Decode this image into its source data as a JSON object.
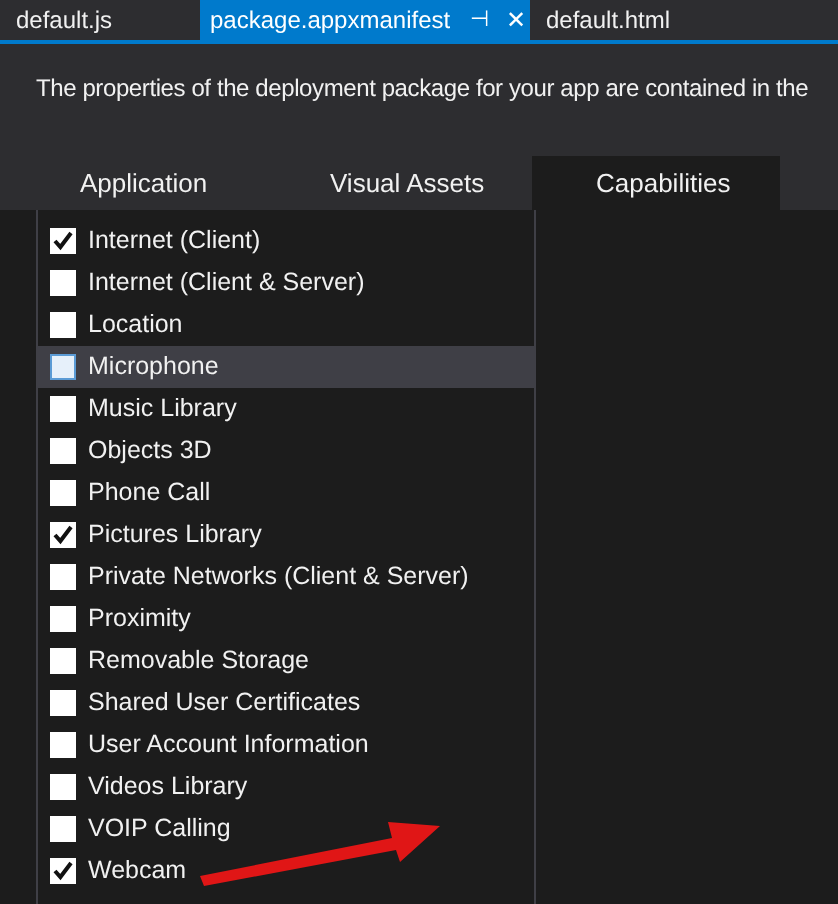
{
  "file_tabs": [
    {
      "label": "default.js",
      "selected": false
    },
    {
      "label": "package.appxmanifest",
      "selected": true,
      "pin": "⊣",
      "close": "✕"
    },
    {
      "label": "default.html",
      "selected": false
    }
  ],
  "description": "The properties of the deployment package for your app are contained in the",
  "tabs": [
    {
      "label": "Application",
      "selected": false
    },
    {
      "label": "Visual Assets",
      "selected": false
    },
    {
      "label": "Capabilities",
      "selected": true
    }
  ],
  "capabilities": [
    {
      "label": "Internet (Client)",
      "checked": true,
      "selected": false
    },
    {
      "label": "Internet (Client & Server)",
      "checked": false,
      "selected": false
    },
    {
      "label": "Location",
      "checked": false,
      "selected": false
    },
    {
      "label": "Microphone",
      "checked": false,
      "selected": true
    },
    {
      "label": "Music Library",
      "checked": false,
      "selected": false
    },
    {
      "label": "Objects 3D",
      "checked": false,
      "selected": false
    },
    {
      "label": "Phone Call",
      "checked": false,
      "selected": false
    },
    {
      "label": "Pictures Library",
      "checked": true,
      "selected": false
    },
    {
      "label": "Private Networks (Client & Server)",
      "checked": false,
      "selected": false
    },
    {
      "label": "Proximity",
      "checked": false,
      "selected": false
    },
    {
      "label": "Removable Storage",
      "checked": false,
      "selected": false
    },
    {
      "label": "Shared User Certificates",
      "checked": false,
      "selected": false
    },
    {
      "label": "User Account Information",
      "checked": false,
      "selected": false
    },
    {
      "label": "Videos Library",
      "checked": false,
      "selected": false
    },
    {
      "label": "VOIP Calling",
      "checked": false,
      "selected": false
    },
    {
      "label": "Webcam",
      "checked": true,
      "selected": false
    }
  ]
}
